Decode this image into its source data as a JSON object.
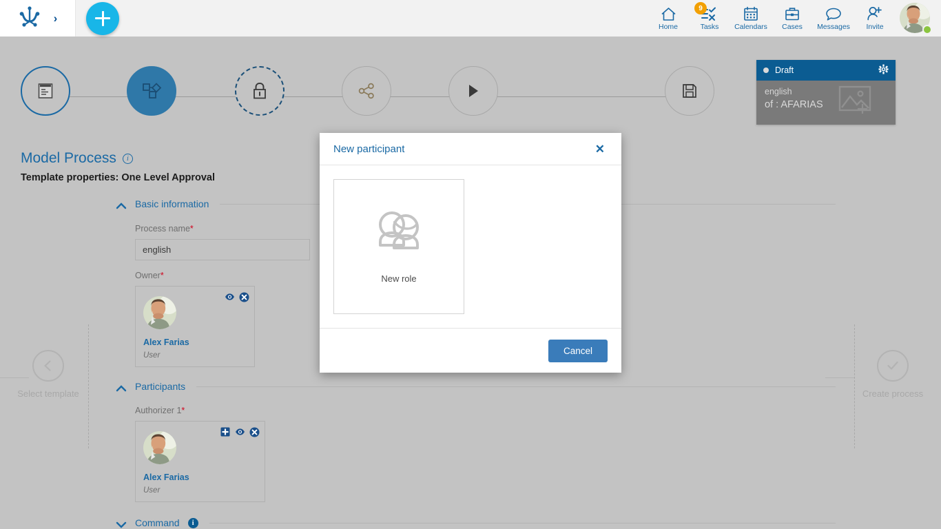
{
  "topbar": {
    "logo_icon": "anchor-logo-icon",
    "expand_icon": "chevron-right-icon",
    "add_label": "+",
    "nav": [
      {
        "label": "Home",
        "icon": "home-icon",
        "badge": null
      },
      {
        "label": "Tasks",
        "icon": "checklist-icon",
        "badge": "9"
      },
      {
        "label": "Calendars",
        "icon": "calendar-icon",
        "badge": null
      },
      {
        "label": "Cases",
        "icon": "briefcase-icon",
        "badge": null
      },
      {
        "label": "Messages",
        "icon": "chat-bubble-icon",
        "badge": null
      },
      {
        "label": "Invite",
        "icon": "user-plus-icon",
        "badge": null
      }
    ],
    "avatar_name": "user-avatar",
    "status": "online"
  },
  "stepper": {
    "steps": [
      {
        "name": "template",
        "icon": "document-list-icon",
        "state": "done"
      },
      {
        "name": "model",
        "icon": "shapes-icon",
        "state": "active"
      },
      {
        "name": "policy",
        "icon": "lock-icon",
        "state": "pending"
      },
      {
        "name": "share",
        "icon": "share-icon",
        "state": "idle"
      },
      {
        "name": "run",
        "icon": "play-icon",
        "state": "idle"
      },
      {
        "name": "save",
        "icon": "floppy-disk-icon",
        "state": "idle"
      }
    ]
  },
  "draft_card": {
    "status_label": "Draft",
    "gear_icon": "gear-icon",
    "line1": "english",
    "line2": "of : AFARIAS",
    "watermark_icon": "image-placeholder-icon"
  },
  "header": {
    "title": "Model Process",
    "info_icon": "info-outline-icon",
    "subtitle": "Template properties: One Level Approval"
  },
  "sections": {
    "basic": {
      "label": "Basic information",
      "chevron": "chevron-up-icon",
      "fields": {
        "process_name_label": "Process name",
        "process_name_required": "*",
        "process_name_value": "english",
        "process_name_placeholder": "Process name",
        "owner_label": "Owner",
        "owner_required": "*"
      },
      "owner_card": {
        "name": "Alex Farias",
        "role": "User",
        "actions": [
          {
            "name": "view-icon",
            "icon": "eye-icon"
          },
          {
            "name": "remove-icon",
            "icon": "close-circle-icon"
          }
        ]
      }
    },
    "participants": {
      "label": "Participants",
      "chevron": "chevron-up-icon",
      "authorizer_label": "Authorizer 1",
      "authorizer_required": "*",
      "authorizer_card": {
        "name": "Alex Farias",
        "role": "User",
        "actions": [
          {
            "name": "add-participant-icon",
            "icon": "plus-square-icon"
          },
          {
            "name": "view-icon",
            "icon": "eye-icon"
          },
          {
            "name": "remove-icon",
            "icon": "close-circle-icon"
          }
        ]
      }
    },
    "command": {
      "label": "Command",
      "chevron": "chevron-down-icon",
      "info_icon": "info-filled-icon"
    }
  },
  "bottom_nav": {
    "prev_label": "Select template",
    "prev_icon": "chevron-left-circle-icon",
    "next_label": "Create process",
    "next_icon": "check-circle-icon"
  },
  "modal": {
    "title": "New participant",
    "close_icon": "close-icon",
    "tile": {
      "label": "New role",
      "icon": "group-people-icon"
    },
    "cancel_label": "Cancel"
  },
  "colors": {
    "brand_blue": "#1a69a4",
    "dark_blue": "#0b5c92",
    "cyan": "#18b6e8",
    "orange": "#f2a003",
    "green": "#8bc53f",
    "overlay_gray": "#c3c3c3",
    "button_blue": "#3a7cba"
  }
}
